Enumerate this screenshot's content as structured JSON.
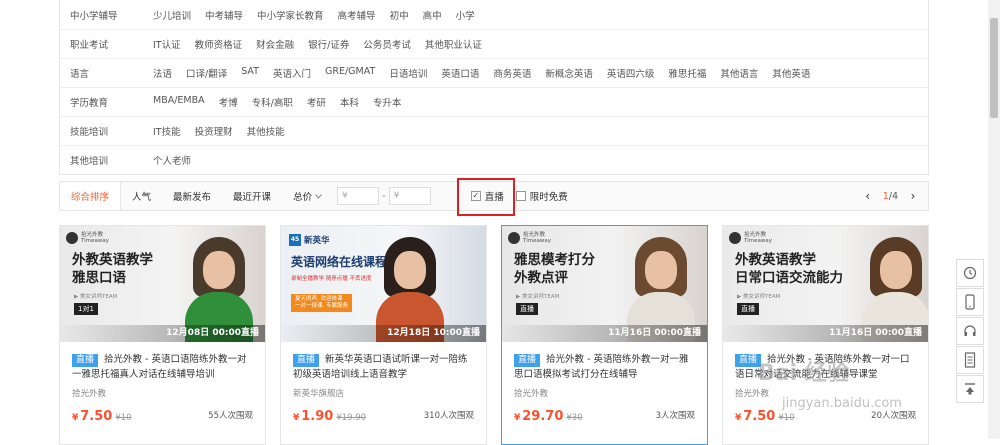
{
  "filters": [
    {
      "name": "中小学辅导",
      "items": [
        "少儿培训",
        "中考辅导",
        "中小学家长教育",
        "高考辅导",
        "初中",
        "高中",
        "小学"
      ]
    },
    {
      "name": "职业考试",
      "items": [
        "IT认证",
        "教师资格证",
        "财会金融",
        "银行/证券",
        "公务员考试",
        "其他职业认证"
      ]
    },
    {
      "name": "语言",
      "items": [
        "法语",
        "口译/翻译",
        "SAT",
        "英语入门",
        "GRE/GMAT",
        "日语培训",
        "英语口语",
        "商务英语",
        "新概念英语",
        "英语四六级",
        "雅思托福",
        "其他语言",
        "其他英语"
      ]
    },
    {
      "name": "学历教育",
      "items": [
        "MBA/EMBA",
        "考博",
        "专科/高职",
        "考研",
        "本科",
        "专升本"
      ]
    },
    {
      "name": "技能培训",
      "items": [
        "IT技能",
        "投资理财",
        "其他技能"
      ]
    },
    {
      "name": "其他培训",
      "items": [
        "个人老师"
      ]
    }
  ],
  "sortbar": {
    "sorts": [
      "综合排序",
      "人气",
      "最新发布",
      "最近开课",
      "总价"
    ],
    "price_from_placeholder": "¥",
    "price_to_placeholder": "¥",
    "dash": "-",
    "live_label": "直播",
    "free_label": "限时免费",
    "page_current": "1",
    "page_total": "/4",
    "prev_icon": "chevron-left-icon",
    "next_icon": "chevron-right-icon"
  },
  "cards": [
    {
      "thumb_title_1": "外教英语教学",
      "thumb_title_2": "雅思口语",
      "thumb_sub": "▶ 美女讲师TEAM",
      "thumb_tag": "1对1",
      "time": "12月08日 00:00直播",
      "badge": "直播",
      "title": "拾光外教 - 英语口语陪练外教一对一雅思托福真人对话在线辅导培训",
      "org": "拾光外教",
      "price": "7.50",
      "orig": "¥10",
      "views": "55人次围观"
    },
    {
      "thumb_logo": "新英华",
      "thumb_title_1": "英语网络在线课程",
      "thumb_sub": "录制全播教学 随停点播 不丢进度",
      "thumb_promo_1": "夏天闹声, 欢迎体课",
      "thumb_promo_2": "一对一授课, 专属服务",
      "time": "12月18日 10:00直播",
      "badge": "直播",
      "title": "新英华英语口语试听课一对一陪练初级英语培训线上语音教学",
      "org": "新英华旗舰店",
      "price": "1.90",
      "orig": "¥19.90",
      "views": "310人次围观"
    },
    {
      "thumb_title_1": "雅思模考打分",
      "thumb_title_2": "外教点评",
      "thumb_sub": "▶ 美女讲师TEAM",
      "thumb_tag": "直播",
      "time": "11月16日 00:00直播",
      "badge": "直播",
      "title": "拾光外教 - 英语陪练外教一对一雅思口语模拟考试打分在线辅导",
      "org": "拾光外教",
      "price": "29.70",
      "orig": "¥30",
      "views": "3人次围观"
    },
    {
      "thumb_title_1": "外教英语教学",
      "thumb_title_2": "日常口语交流能力",
      "thumb_sub": "▶ 美女讲师TEAM",
      "thumb_tag": "直播",
      "time": "11月16日 00:00直播",
      "badge": "直播",
      "title": "拾光外教 - 英语陪练外教一对一口语日常对话交流能力在线辅导课堂",
      "org": "拾光外教",
      "price": "7.50",
      "orig": "¥10",
      "views": "20人次围观"
    }
  ],
  "currency": "¥",
  "sidebar_icons": [
    "history-icon",
    "mobile-icon",
    "headset-icon",
    "document-icon",
    "back-to-top-icon"
  ],
  "watermark": "Bai 经验",
  "watermark_url": "jingyan.baidu.com",
  "colors": {
    "accent": "#ff5b2b",
    "price": "#ff4f2b",
    "live_badge": "#3fa0ec",
    "highlight_box": "#e02020"
  }
}
